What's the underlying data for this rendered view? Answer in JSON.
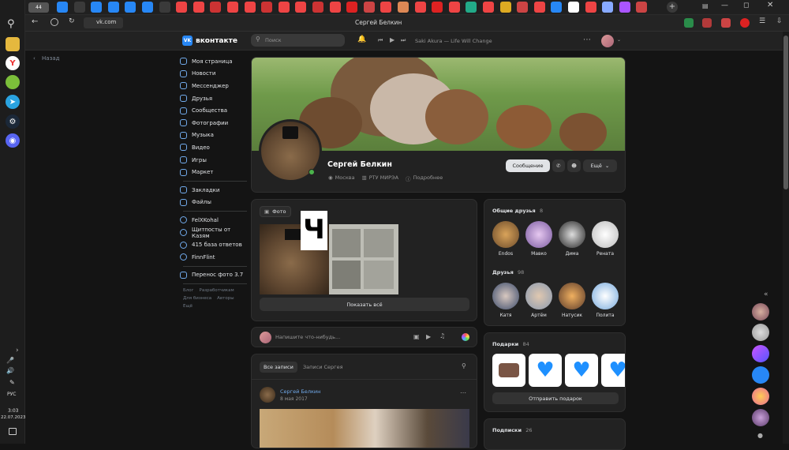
{
  "browser": {
    "address": "vk.com",
    "page_title": "Сергей Белкин",
    "nav_label": "Назад"
  },
  "taskbar": {
    "lang": "РУС",
    "time": "3:03",
    "date": "22.07.2023"
  },
  "header": {
    "logo_text": "вконтакте",
    "search_placeholder": "Поиск",
    "now_playing": "Saki Akura — Life Will Change"
  },
  "menu": {
    "main": [
      "Моя страница",
      "Новости",
      "Мессенджер",
      "Друзья",
      "Сообщества",
      "Фотографии",
      "Музыка",
      "Видео",
      "Игры",
      "Маркет"
    ],
    "secondary": [
      "Закладки",
      "Файлы"
    ],
    "groups": [
      "FelXKohal",
      "Щитпосты от Казям",
      "415 база ответов",
      "FinnFlint"
    ],
    "apps": [
      "Перенос фото 3.7"
    ],
    "footer": [
      "Блог",
      "Разработчикам",
      "Для бизнеса",
      "Авторы",
      "Ещё"
    ]
  },
  "profile": {
    "name": "Сергей Белкин",
    "city": "Москва",
    "university": "РТУ МИРЭА",
    "details": "Подробнее",
    "message_btn": "Сообщение",
    "more_btn": "Ещё"
  },
  "photos": {
    "label": "Фото",
    "overlay_text": "Ч",
    "show_all": "Показать всё"
  },
  "compose": {
    "placeholder": "Напишите что-нибудь..."
  },
  "wall": {
    "tab_all": "Все записи",
    "tab_user": "Записи Сергея",
    "post_author": "Сергей Белкин",
    "post_date": "8 мая 2017"
  },
  "common_friends": {
    "title": "Общие друзья",
    "count": "8",
    "names": [
      "Endos",
      "Мавко",
      "Дима",
      "Рената"
    ]
  },
  "friends": {
    "title": "Друзья",
    "count": "98",
    "names": [
      "Катя",
      "Артём",
      "Натусик",
      "Полита"
    ]
  },
  "gifts": {
    "title": "Подарки",
    "count": "84",
    "send_btn": "Отправить подарок"
  },
  "subscriptions": {
    "title": "Подписки",
    "count": "26"
  },
  "colors": {
    "accent": "#2787f5",
    "link": "#71aaeb",
    "bg": "#141414",
    "card": "#222222"
  }
}
